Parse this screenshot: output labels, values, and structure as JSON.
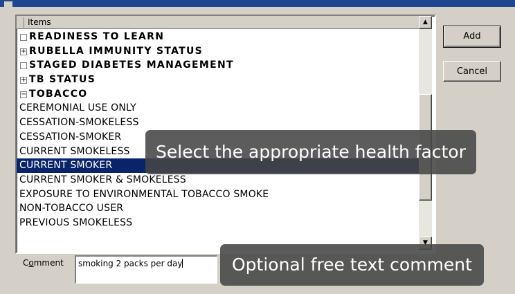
{
  "list": {
    "header": "Items",
    "rows": [
      {
        "label": "READINESS TO LEARN",
        "toggle": "",
        "bold": true
      },
      {
        "label": "RUBELLA IMMUNITY STATUS",
        "toggle": "+",
        "bold": true
      },
      {
        "label": "STAGED DIABETES MANAGEMENT",
        "toggle": "",
        "bold": true
      },
      {
        "label": "TB STATUS",
        "toggle": "+",
        "bold": true
      },
      {
        "label": "TOBACCO",
        "toggle": "−",
        "bold": true
      },
      {
        "label": "CEREMONIAL USE ONLY"
      },
      {
        "label": "CESSATION-SMOKELESS"
      },
      {
        "label": "CESSATION-SMOKER"
      },
      {
        "label": "CURRENT SMOKELESS"
      },
      {
        "label": "CURRENT SMOKER",
        "selected": true
      },
      {
        "label": "CURRENT SMOKER & SMOKELESS"
      },
      {
        "label": "EXPOSURE TO ENVIRONMENTAL TOBACCO SMOKE"
      },
      {
        "label": "NON-TOBACCO USER"
      },
      {
        "label": "PREVIOUS SMOKELESS"
      }
    ]
  },
  "buttons": {
    "add": "Add",
    "cancel": "Cancel"
  },
  "comment": {
    "label_mnemonic": "o",
    "label_first": "C",
    "label_rest": "mment",
    "value": "smoking 2 packs per day"
  },
  "tooltips": {
    "select": "Select the appropriate health factor",
    "comment": "Optional free text comment"
  },
  "colors": {
    "selection": "#0a246a",
    "face": "#d4d0c8",
    "titlebar": "#1f4690"
  },
  "icons": {
    "scroll_up": "triangle-up",
    "scroll_down": "triangle-down",
    "expand": "plus-box",
    "collapse": "minus-box",
    "empty": "empty-box"
  }
}
